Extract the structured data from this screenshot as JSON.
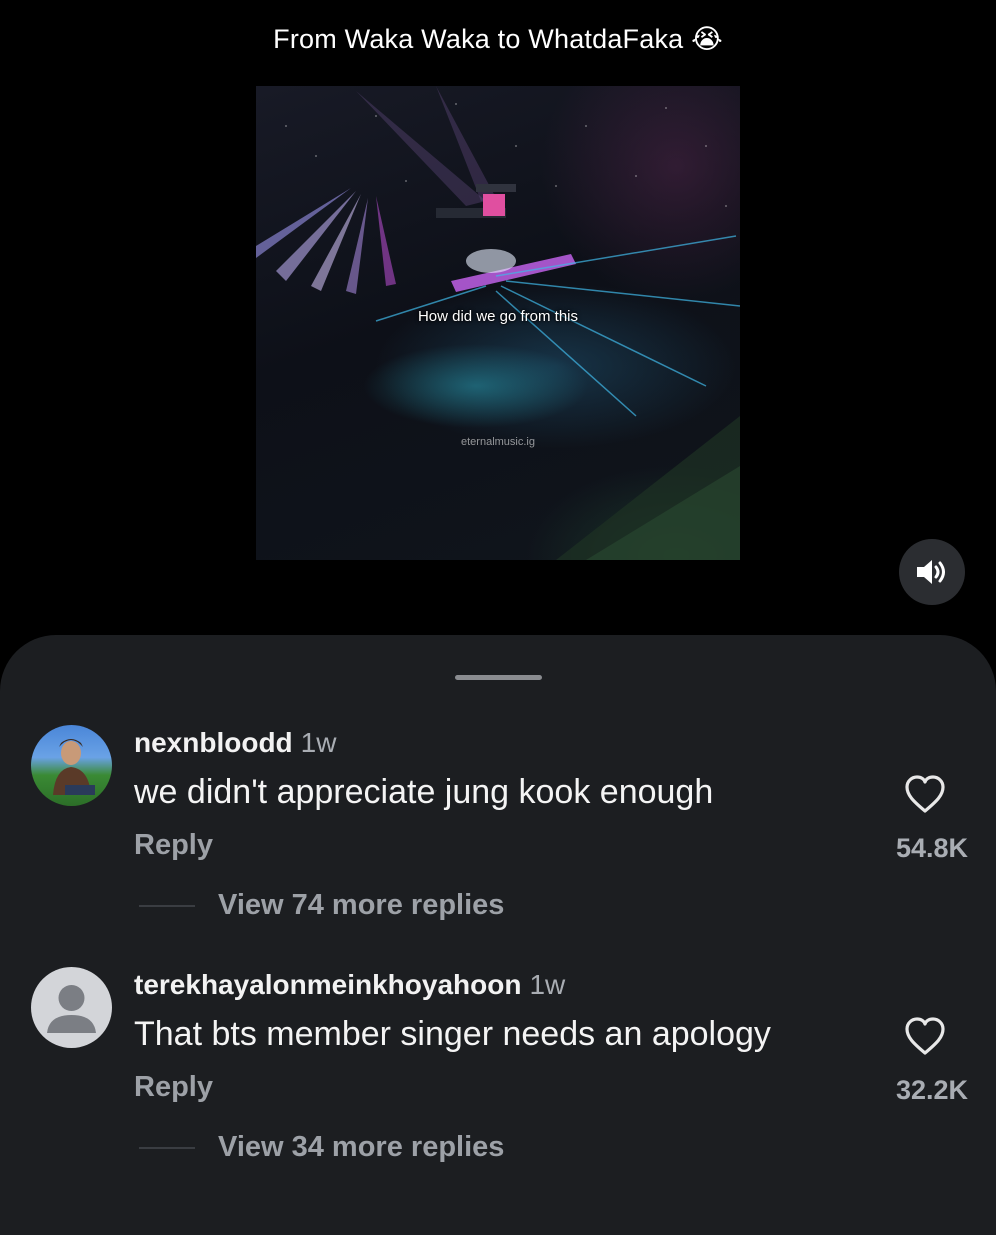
{
  "post": {
    "caption": "From Waka Waka to WhatdaFaka",
    "caption_emoji": "😭",
    "video": {
      "overlay_text": "How did we go from this",
      "watermark": "eternalmusic.ig"
    },
    "sound_icon": "speaker-volume-icon"
  },
  "comments_sheet": {
    "background": "#1c1e21",
    "comments": [
      {
        "username": "nexnbloodd",
        "time": "1w",
        "text": "we didn't appreciate jung kook enough",
        "reply_label": "Reply",
        "likes": "54.8K",
        "view_replies": "View 74 more replies",
        "avatar": "user-photo-avatar"
      },
      {
        "username": "terekhayalonmeinkhoyahoon",
        "time": "1w",
        "text": "That bts member singer needs an apology",
        "reply_label": "Reply",
        "likes": "32.2K",
        "view_replies": "View 34 more replies",
        "avatar": "default-avatar"
      }
    ]
  }
}
